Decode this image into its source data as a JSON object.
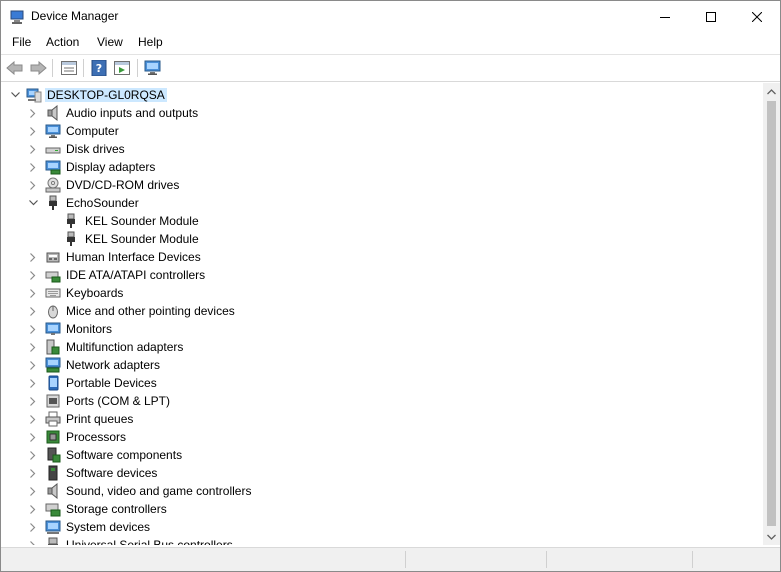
{
  "window": {
    "title": "Device Manager"
  },
  "menu": {
    "file": "File",
    "action": "Action",
    "view": "View",
    "help": "Help"
  },
  "toolbar": [
    "back-icon",
    "forward-icon",
    "properties-view-icon",
    "help-icon",
    "run-view-icon",
    "monitor-scan-icon"
  ],
  "tree": {
    "root": "DESKTOP-GL0RQSA",
    "categories": [
      {
        "label": "Audio inputs and outputs",
        "icon": "speaker-icon",
        "expanded": false
      },
      {
        "label": "Computer",
        "icon": "computer-icon",
        "expanded": false
      },
      {
        "label": "Disk drives",
        "icon": "disk-drive-icon",
        "expanded": false
      },
      {
        "label": "Display adapters",
        "icon": "display-adapter-icon",
        "expanded": false
      },
      {
        "label": "DVD/CD-ROM drives",
        "icon": "dvd-drive-icon",
        "expanded": false
      },
      {
        "label": "EchoSounder",
        "icon": "usb-plug-icon",
        "expanded": true,
        "children": [
          "KEL Sounder Module",
          "KEL Sounder Module"
        ]
      },
      {
        "label": "Human Interface Devices",
        "icon": "hid-icon",
        "expanded": false
      },
      {
        "label": "IDE ATA/ATAPI controllers",
        "icon": "ide-controller-icon",
        "expanded": false
      },
      {
        "label": "Keyboards",
        "icon": "keyboard-icon",
        "expanded": false
      },
      {
        "label": "Mice and other pointing devices",
        "icon": "mouse-icon",
        "expanded": false
      },
      {
        "label": "Monitors",
        "icon": "monitor-icon",
        "expanded": false
      },
      {
        "label": "Multifunction adapters",
        "icon": "multifunction-icon",
        "expanded": false
      },
      {
        "label": "Network adapters",
        "icon": "network-adapter-icon",
        "expanded": false
      },
      {
        "label": "Portable Devices",
        "icon": "portable-device-icon",
        "expanded": false
      },
      {
        "label": "Ports (COM & LPT)",
        "icon": "port-icon",
        "expanded": false
      },
      {
        "label": "Print queues",
        "icon": "printer-icon",
        "expanded": false
      },
      {
        "label": "Processors",
        "icon": "processor-icon",
        "expanded": false
      },
      {
        "label": "Software components",
        "icon": "software-component-icon",
        "expanded": false
      },
      {
        "label": "Software devices",
        "icon": "software-device-icon",
        "expanded": false
      },
      {
        "label": "Sound, video and game controllers",
        "icon": "sound-controller-icon",
        "expanded": false
      },
      {
        "label": "Storage controllers",
        "icon": "storage-controller-icon",
        "expanded": false
      },
      {
        "label": "System devices",
        "icon": "system-device-icon",
        "expanded": false
      },
      {
        "label": "Universal Serial Bus controllers",
        "icon": "usb-controller-icon",
        "expanded": false
      }
    ]
  }
}
